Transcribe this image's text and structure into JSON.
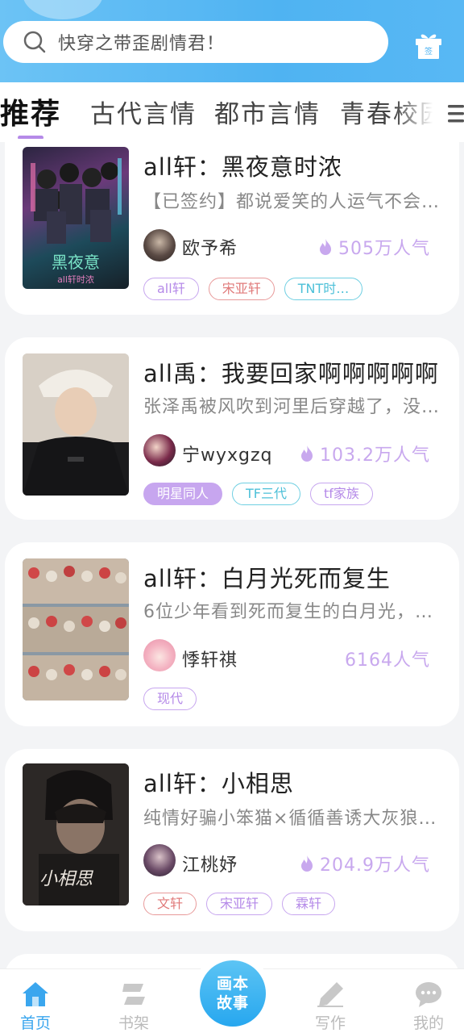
{
  "search": {
    "placeholder": "快穿之带歪剧情君！"
  },
  "header": {
    "signin_label": "签"
  },
  "tabs": [
    {
      "label": "推荐"
    },
    {
      "label": "古代言情"
    },
    {
      "label": "都市言情"
    },
    {
      "label": "青春校园"
    }
  ],
  "cards": [
    {
      "title": "all轩：黑夜意时浓",
      "desc": "【已签约】都说爱笑的人运气不会…",
      "author": "欧予希",
      "popularity": "505万人气",
      "tags": [
        {
          "label": "all轩",
          "style": "purple"
        },
        {
          "label": "宋亚轩",
          "style": "red"
        },
        {
          "label": "TNT时…",
          "style": "cyan"
        }
      ]
    },
    {
      "title": "all禹：我要回家啊啊啊啊啊",
      "desc": "张泽禹被风吹到河里后穿越了，没…",
      "author": "宁wyxgzq",
      "popularity": "103.2万人气",
      "tags": [
        {
          "label": "明星同人",
          "style": "filled"
        },
        {
          "label": "TF三代",
          "style": "cyan"
        },
        {
          "label": "tf家族",
          "style": "purple"
        }
      ]
    },
    {
      "title": "all轩：白月光死而复生",
      "desc": "6位少年看到死而复生的白月光，…",
      "author": "悸轩祺",
      "popularity": "6164人气",
      "tags": [
        {
          "label": "现代",
          "style": "purple"
        }
      ]
    },
    {
      "title": "all轩：小相思",
      "desc": "纯情好骗小笨猫×循循善诱大灰狼…",
      "author": "江桃妤",
      "popularity": "204.9万人气",
      "tags": [
        {
          "label": "文轩",
          "style": "red"
        },
        {
          "label": "宋亚轩",
          "style": "purple"
        },
        {
          "label": "霖轩",
          "style": "purple"
        }
      ]
    }
  ],
  "nav": {
    "home": "首页",
    "bookshelf": "书架",
    "fab_line1": "画本",
    "fab_line2": "故事",
    "write": "写作",
    "mine": "我的"
  },
  "colors": {
    "accent": "#3aa6ee",
    "tag_purple": "#b58ae8",
    "popularity": "#c8a8ee"
  }
}
